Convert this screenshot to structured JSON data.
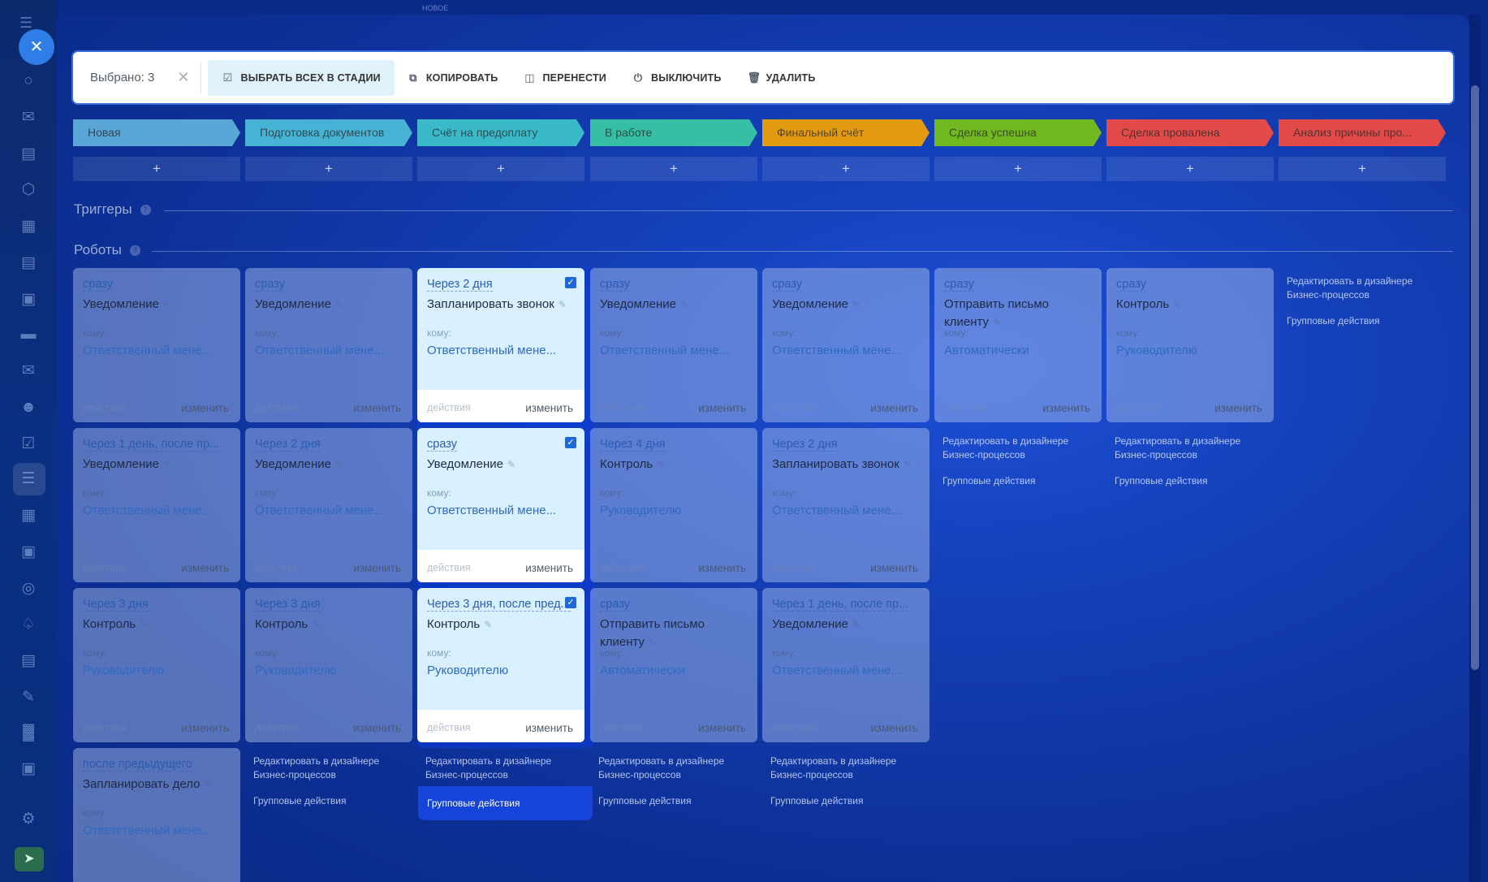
{
  "toolbar": {
    "selected_label": "Выбрано: 3",
    "select_all_label": "ВЫБРАТЬ ВСЕХ В СТАДИИ",
    "copy_label": "КОПИРОВАТЬ",
    "move_label": "ПЕРЕНЕСТИ",
    "disable_label": "ВЫКЛЮЧИТЬ",
    "delete_label": "УДАЛИТЬ"
  },
  "top_ghost_label": "НОВОЕ",
  "stages": [
    {
      "label": "Новая",
      "color": "#5aa6d6"
    },
    {
      "label": "Подготовка документов",
      "color": "#47b3d4"
    },
    {
      "label": "Счёт на предоплату",
      "color": "#3ab9c9"
    },
    {
      "label": "В работе",
      "color": "#37bfa6"
    },
    {
      "label": "Финальный счёт",
      "color": "#e39a13"
    },
    {
      "label": "Сделка успешна",
      "color": "#72b820"
    },
    {
      "label": "Сделка провалена",
      "color": "#e24a4a"
    },
    {
      "label": "Анализ причины про...",
      "color": "#e24a4a"
    }
  ],
  "add_label": "+",
  "triggers_title": "Триггеры",
  "robots_title": "Роботы",
  "help_glyph": "?",
  "card_to_label": "кому:",
  "card_actions_label": "действия",
  "card_edit_label": "изменить",
  "edit_designer_label": "Редактировать в дизайнере Бизнес-процессов",
  "group_actions_label": "Групповые действия",
  "robots": [
    [
      {
        "when": "сразу",
        "title": "Уведомление",
        "who": "Ответственный мене..."
      },
      {
        "when": "Через 1 день, после пр...",
        "title": "Уведомление",
        "who": "Ответственный мене..."
      },
      {
        "when": "Через 3 дня",
        "title": "Контроль",
        "who": "Руководителю"
      },
      {
        "when": "после предыдущего",
        "title": "Запланировать дело",
        "who": "Ответственный мене..."
      }
    ],
    [
      {
        "when": "сразу",
        "title": "Уведомление",
        "who": "Ответственный мене..."
      },
      {
        "when": "Через 2 дня",
        "title": "Уведомление",
        "who": "Ответственный мене..."
      },
      {
        "when": "Через 3 дня",
        "title": "Контроль",
        "who": "Руководителю"
      }
    ],
    [
      {
        "when": "Через 2 дня",
        "title": "Запланировать звонок",
        "who": "Ответственный мене...",
        "selected": true
      },
      {
        "when": "сразу",
        "title": "Уведомление",
        "who": "Ответственный мене...",
        "selected": true
      },
      {
        "when": "Через 3 дня, после пред...",
        "title": "Контроль",
        "who": "Руководителю",
        "selected": true
      }
    ],
    [
      {
        "when": "сразу",
        "title": "Уведомление",
        "who": "Ответственный мене..."
      },
      {
        "when": "Через 4 дня",
        "title": "Контроль",
        "who": "Руководителю"
      },
      {
        "when": "сразу",
        "title": "Отправить письмо клиенту",
        "who": "Автоматически"
      }
    ],
    [
      {
        "when": "сразу",
        "title": "Уведомление",
        "who": "Ответственный мене..."
      },
      {
        "when": "Через 2 дня",
        "title": "Запланировать звонок",
        "who": "Ответственный мене..."
      },
      {
        "when": "Через 1 день, после пр...",
        "title": "Уведомление",
        "who": "Ответственный мене..."
      }
    ],
    [
      {
        "when": "сразу",
        "title": "Отправить письмо клиенту",
        "who": "Автоматически"
      }
    ],
    [
      {
        "when": "сразу",
        "title": "Контроль",
        "who": "Руководителю"
      }
    ],
    []
  ],
  "sidebar_icons": [
    "chat-icon",
    "feed-icon",
    "tasks-icon",
    "circle-icon",
    "calendar-icon",
    "doc-icon",
    "board-icon",
    "card-icon",
    "mail-icon",
    "contacts-icon",
    "check-icon",
    "crm-icon",
    "calendar2-icon",
    "shop-icon",
    "target-icon",
    "cart-icon",
    "invoice-icon",
    "sign-icon",
    "chart-icon",
    "support-icon",
    "settings-icon"
  ]
}
